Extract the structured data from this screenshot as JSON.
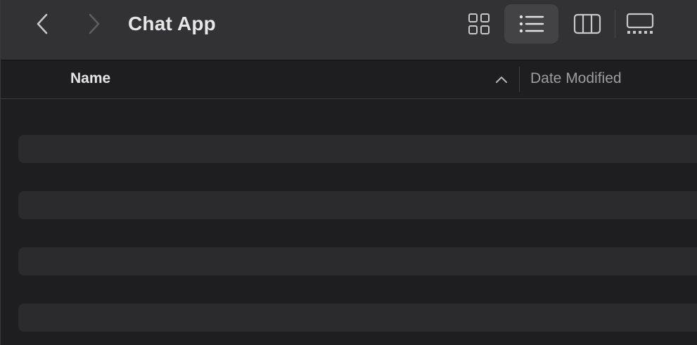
{
  "window": {
    "title": "Chat App"
  },
  "toolbar": {
    "back_icon": "chevron-left-icon",
    "forward_icon": "chevron-right-icon",
    "views": [
      {
        "name": "icon-view",
        "icon": "grid-icon",
        "selected": false
      },
      {
        "name": "list-view",
        "icon": "list-icon",
        "selected": true
      },
      {
        "name": "column-view",
        "icon": "columns-icon",
        "selected": false
      },
      {
        "name": "gallery-view",
        "icon": "gallery-icon",
        "selected": false
      }
    ]
  },
  "list_header": {
    "name_label": "Name",
    "date_label": "Date Modified",
    "sort_icon": "chevron-up-icon"
  },
  "rows": [
    {
      "name": ""
    },
    {
      "name": ""
    },
    {
      "name": ""
    },
    {
      "name": ""
    }
  ],
  "colors": {
    "toolbar_bg": "#323234",
    "content_bg": "#1e1e20",
    "row_stripe": "#2b2b2d",
    "selected_view_bg": "#434346",
    "icon_color": "#c8c8ca"
  }
}
